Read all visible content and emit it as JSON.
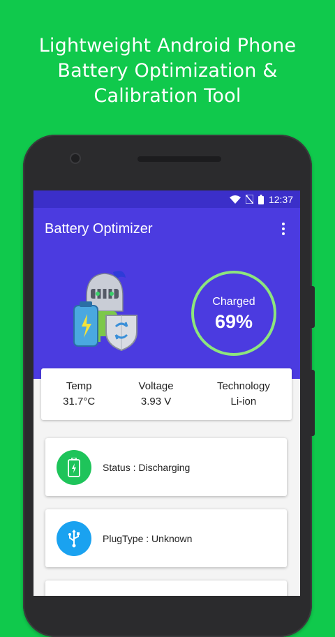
{
  "promo": {
    "line1": "Lightweight Android Phone",
    "line2": "Battery Optimization &",
    "line3": "Calibration Tool"
  },
  "status_bar": {
    "time": "12:37",
    "icons": [
      "wifi-icon",
      "no-sim-icon",
      "battery-icon"
    ]
  },
  "app_bar": {
    "title": "Battery Optimizer",
    "menu_icon": "overflow-menu-icon"
  },
  "charge": {
    "label": "Charged",
    "percent": "69%"
  },
  "stats": [
    {
      "label": "Temp",
      "value": "31.7°C"
    },
    {
      "label": "Voltage",
      "value": "3.93 V"
    },
    {
      "label": "Technology",
      "value": "Li-ion"
    }
  ],
  "cards": [
    {
      "icon": "battery-status-icon",
      "text": "Status : Discharging",
      "color": "#1ec45a"
    },
    {
      "icon": "usb-icon",
      "text": "PlugType : Unknown",
      "color": "#1aa2f0"
    }
  ],
  "colors": {
    "page_background": "#10c94c",
    "app_primary": "#4b3be0",
    "status_bar": "#3b2fc9",
    "ring": "#8de57d"
  }
}
